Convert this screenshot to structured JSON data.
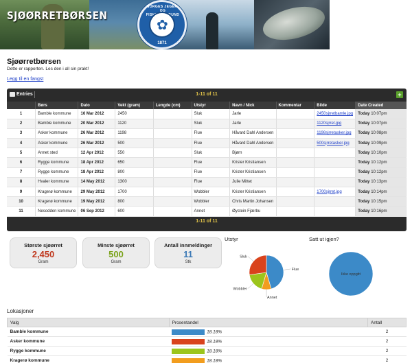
{
  "banner": {
    "title": "SJØØRRETBØRSEN",
    "badge_text": "NORGES JEGER- OG FISKERFORBUND",
    "badge_year": "1871"
  },
  "intro": {
    "title": "Sjøørretbørsen",
    "subtitle": "Dette er rapporten. Les den i all sin prakt!",
    "add_link": "Legg til en fangst"
  },
  "entries": {
    "label": "Entries",
    "count": "1-11 of 11",
    "add_label": "+",
    "columns": [
      "",
      "Børs",
      "Dato",
      "Vekt (gram)",
      "Lengde (cm)",
      "Utstyr",
      "Navn / Nick",
      "Kommentar",
      "Bilde",
      "Date Created"
    ],
    "rows": [
      {
        "n": "1",
        "bors": "Bamble kommune",
        "dato": "16 Mar 2012",
        "vekt": "2450",
        "lengde": "",
        "utstyr": "Sluk",
        "navn": "Jarle",
        "kommentar": "",
        "bilde": "2450sjrretbamle.jpg",
        "day": "Today",
        "time": "10:07pm"
      },
      {
        "n": "2",
        "bors": "Bamble kommune",
        "dato": "20 Mar 2012",
        "vekt": "1120",
        "lengde": "",
        "utstyr": "Sluk",
        "navn": "Jarle",
        "kommentar": "",
        "bilde": "1120sjrret.jpg",
        "day": "Today",
        "time": "10:07pm"
      },
      {
        "n": "3",
        "bors": "Asker kommune",
        "dato": "26 Mar 2012",
        "vekt": "1198",
        "lengde": "",
        "utstyr": "Flue",
        "navn": "Håvard Dahl Andersen",
        "kommentar": "",
        "bilde": "1198sjrretasker.jpg",
        "day": "Today",
        "time": "10:08pm"
      },
      {
        "n": "4",
        "bors": "Asker kommune",
        "dato": "26 Mar 2012",
        "vekt": "500",
        "lengde": "",
        "utstyr": "Flue",
        "navn": "Håvard Dahl Andersen",
        "kommentar": "",
        "bilde": "500sjrretasker.jpg",
        "day": "Today",
        "time": "10:09pm"
      },
      {
        "n": "5",
        "bors": "Annet sted",
        "dato": "12 Apr 2012",
        "vekt": "550",
        "lengde": "",
        "utstyr": "Sluk",
        "navn": "Bjørn",
        "kommentar": "",
        "bilde": "",
        "day": "Today",
        "time": "10:10pm"
      },
      {
        "n": "6",
        "bors": "Rygge kommune",
        "dato": "18 Apr 2012",
        "vekt": "650",
        "lengde": "",
        "utstyr": "Flue",
        "navn": "Krister Kristiansen",
        "kommentar": "",
        "bilde": "",
        "day": "Today",
        "time": "10:12pm"
      },
      {
        "n": "7",
        "bors": "Rygge kommune",
        "dato": "18 Apr 2012",
        "vekt": "800",
        "lengde": "",
        "utstyr": "Flue",
        "navn": "Krister Kristiansen",
        "kommentar": "",
        "bilde": "",
        "day": "Today",
        "time": "10:12pm"
      },
      {
        "n": "8",
        "bors": "Hvaler kommune",
        "dato": "14 May 2012",
        "vekt": "1300",
        "lengde": "",
        "utstyr": "Flue",
        "navn": "Julie Mittet",
        "kommentar": "",
        "bilde": "",
        "day": "Today",
        "time": "10:13pm"
      },
      {
        "n": "9",
        "bors": "Kragerø kommune",
        "dato": "29 May 2012",
        "vekt": "1700",
        "lengde": "",
        "utstyr": "Wobbler",
        "navn": "Krister Kristiansen",
        "kommentar": "",
        "bilde": "1700sjrret.jpg",
        "day": "Today",
        "time": "10:14pm"
      },
      {
        "n": "10",
        "bors": "Kragerø kommune",
        "dato": "19 May 2012",
        "vekt": "800",
        "lengde": "",
        "utstyr": "Wobbler",
        "navn": "Chris Martin Johansen",
        "kommentar": "",
        "bilde": "",
        "day": "Today",
        "time": "10:15pm"
      },
      {
        "n": "11",
        "bors": "Nesodden kommune",
        "dato": "06 Sep 2012",
        "vekt": "600",
        "lengde": "",
        "utstyr": "Annet",
        "navn": "Øystein Fjærbu",
        "kommentar": "",
        "bilde": "",
        "day": "Today",
        "time": "10:16pm"
      }
    ],
    "footer_count": "1-11 of 11"
  },
  "stats": {
    "largest": {
      "title": "Største sjøørret",
      "value": "2,450",
      "unit": "Gram",
      "color": "#c0391f"
    },
    "smallest": {
      "title": "Minste sjøørret",
      "value": "500",
      "unit": "Gram",
      "color": "#7aa21a"
    },
    "count": {
      "title": "Antall innmeldinger",
      "value": "11",
      "unit": "Stk",
      "color": "#3a78b5"
    }
  },
  "utstyr": {
    "title": "Utstyr",
    "slices": [
      {
        "label": "Flue",
        "value": 5,
        "color": "#3c8ac8"
      },
      {
        "label": "Annet",
        "value": 1,
        "color": "#f29d1e"
      },
      {
        "label": "Wobbler",
        "value": 2,
        "color": "#9cc51c"
      },
      {
        "label": "Sluk",
        "value": 3,
        "color": "#d9431c"
      }
    ]
  },
  "satt": {
    "title": "Satt ut igjen?",
    "slices": [
      {
        "label": "Ikke oppgitt",
        "value": 11,
        "color": "#3c8ac8"
      }
    ]
  },
  "lokasjoner": {
    "title": "Lokasjoner",
    "columns": [
      "Valg",
      "Prosentandel",
      "Antall"
    ],
    "rows": [
      {
        "name": "Bamble kommune",
        "pct": "18.18%",
        "count": "2",
        "color": "#3c8ac8"
      },
      {
        "name": "Asker kommune",
        "pct": "18.18%",
        "count": "2",
        "color": "#d9431c"
      },
      {
        "name": "Rygge kommune",
        "pct": "18.18%",
        "count": "2",
        "color": "#9cc51c"
      },
      {
        "name": "Kragerø kommune",
        "pct": "18.18%",
        "count": "2",
        "color": "#f29d1e"
      }
    ]
  }
}
